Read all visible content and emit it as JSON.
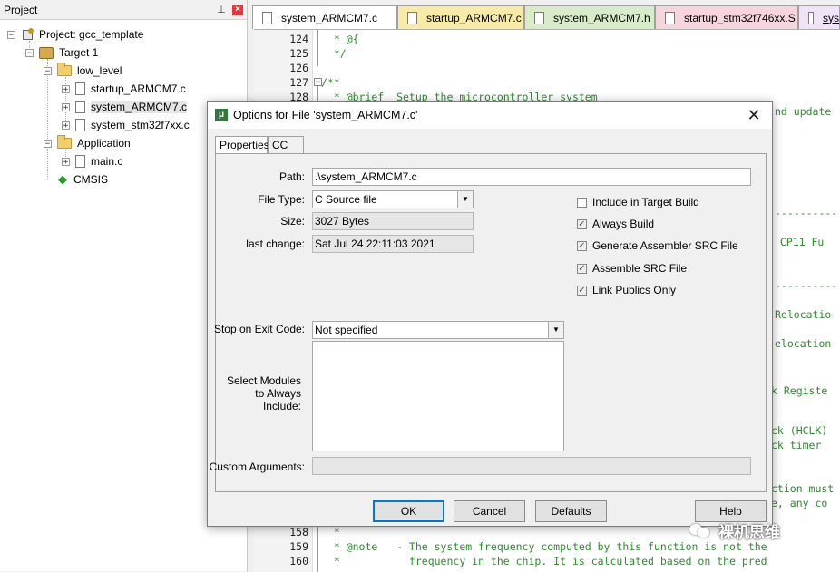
{
  "project_pane": {
    "title": "Project",
    "tree": {
      "project": "Project: gcc_template",
      "target": "Target 1",
      "group_low_level": "low_level",
      "files_low_level": [
        "startup_ARMCM7.c",
        "system_ARMCM7.c",
        "system_stm32f7xx.c"
      ],
      "group_application": "Application",
      "files_application": [
        "main.c"
      ],
      "cmsis": "CMSIS"
    }
  },
  "editor_tabs": [
    {
      "label": "system_ARMCM7.c",
      "color": "#ffffff"
    },
    {
      "label": "startup_ARMCM7.c",
      "color": "#f7eba6"
    },
    {
      "label": "system_ARMCM7.h",
      "color": "#d9ecc9"
    },
    {
      "label": "startup_stm32f746xx.S",
      "color": "#f6d6dc"
    },
    {
      "label": "sys",
      "color": "#f0e3f7"
    }
  ],
  "editor": {
    "lines": [
      {
        "no": "124",
        "text": "  * @{"
      },
      {
        "no": "125",
        "text": "  */"
      },
      {
        "no": "126",
        "text": ""
      },
      {
        "no": "127",
        "text": "/**"
      },
      {
        "no": "128",
        "text": "  * @brief  Setup the microcontroller system"
      }
    ],
    "bottom_lines": [
      {
        "no": "158",
        "text": "  *"
      },
      {
        "no": "159",
        "text": "  * @note   - The system frequency computed by this function is not the"
      },
      {
        "no": "160",
        "text": "  *           frequency in the chip. It is calculated based on the pred"
      }
    ],
    "right_fragments": [
      "nd update",
      "----------",
      "d CP11 Fu",
      "----------",
      "Relocatio",
      "elocation",
      "k Registe",
      "ck (HCLK)",
      "ck timer",
      "ction must",
      "e, any co"
    ]
  },
  "dialog": {
    "title": "Options for File 'system_ARMCM7.c'",
    "tabs": [
      "Properties",
      "CC"
    ],
    "path_label": "Path:",
    "path_value": ".\\system_ARMCM7.c",
    "file_type_label": "File Type:",
    "file_type_value": "C Source file",
    "size_label": "Size:",
    "size_value": "3027 Bytes",
    "last_change_label": "last change:",
    "last_change_value": "Sat Jul 24 22:11:03 2021",
    "checkboxes": [
      {
        "label": "Include in Target Build",
        "checked": false
      },
      {
        "label": "Always Build",
        "checked": true
      },
      {
        "label": "Generate Assembler SRC File",
        "checked": true
      },
      {
        "label": "Assemble SRC File",
        "checked": true
      },
      {
        "label": "Link Publics Only",
        "checked": true
      }
    ],
    "stop_label": "Stop on Exit Code:",
    "stop_value": "Not specified",
    "modules_label_1": "Select Modules",
    "modules_label_2": "to Always",
    "modules_label_3": "Include:",
    "custom_args_label": "Custom Arguments:",
    "custom_args_value": "",
    "buttons": {
      "ok": "OK",
      "cancel": "Cancel",
      "defaults": "Defaults",
      "help": "Help"
    }
  },
  "watermark": "裸机思维"
}
